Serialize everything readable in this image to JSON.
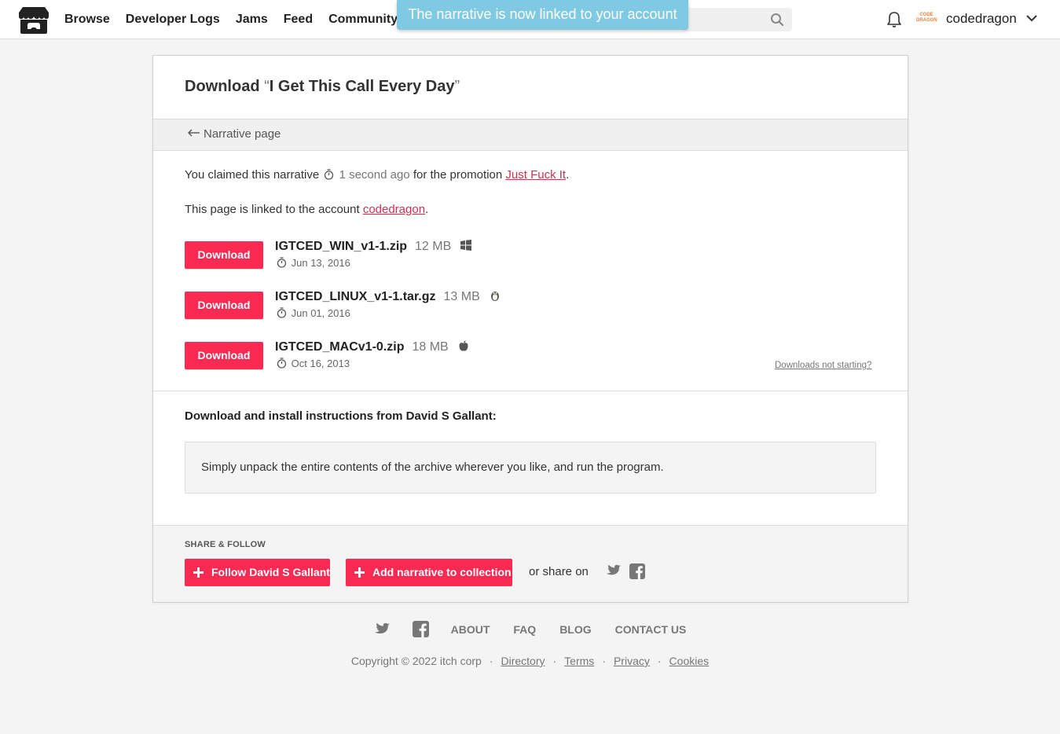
{
  "header": {
    "nav": [
      "Browse",
      "Developer Logs",
      "Jams",
      "Feed",
      "Community"
    ],
    "toast": "The narrative is now linked to your account",
    "avatar_text": "CODE DRAGON",
    "username": "codedragon"
  },
  "page": {
    "title_prefix": "Download ",
    "title_open_quote": "“",
    "title_name": "I Get This Call Every Day",
    "title_close_quote": "”",
    "back_link": "Narrative page",
    "claim_prefix": "You claimed this narrative",
    "claim_time": "1 second ago",
    "claim_middle": "for the promotion",
    "promotion": "Just Fuck It",
    "linked_prefix": "This page is linked to the account",
    "linked_account": "codedragon",
    "downloads": [
      {
        "button": "Download",
        "name": "IGTCED_WIN_v1-1.zip",
        "size": "12 MB",
        "os": "windows-icon",
        "date": "Jun 13, 2016"
      },
      {
        "button": "Download",
        "name": "IGTCED_LINUX_v1-1.tar.gz",
        "size": "13 MB",
        "os": "linux-icon",
        "date": "Jun 01, 2016"
      },
      {
        "button": "Download",
        "name": "IGTCED_MACv1-0.zip",
        "size": "18 MB",
        "os": "apple-icon",
        "date": "Oct 16, 2013"
      }
    ],
    "not_starting": "Downloads not starting?",
    "instructions_heading": "Download and install instructions from David S Gallant:",
    "instructions_text": "Simply unpack the entire contents of the archive wherever you like, and run the program.",
    "share_label": "SHARE & FOLLOW",
    "follow_button": "Follow David S Gallant",
    "collection_button": "Add narrative to collection",
    "share_on": "or share on"
  },
  "footer": {
    "links": [
      "ABOUT",
      "FAQ",
      "BLOG",
      "CONTACT US"
    ],
    "copyright": "Copyright © 2022 itch corp",
    "legal": [
      "Directory",
      "Terms",
      "Privacy",
      "Cookies"
    ]
  },
  "colors": {
    "accent": "#fa2a53",
    "toast": "#7fc9e2",
    "link": "#d03050"
  }
}
